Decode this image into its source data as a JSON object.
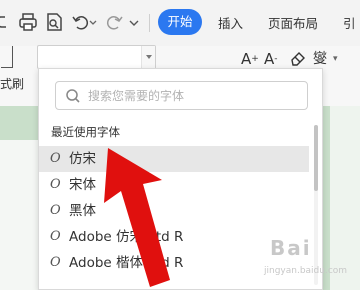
{
  "toolbar": {
    "icons": [
      "link-icon",
      "print-icon",
      "print-preview-icon",
      "undo-icon",
      "undo-dropdown-icon",
      "redo-icon",
      "more-dropdown-icon"
    ],
    "tabs": [
      {
        "label": "开始",
        "active": true
      },
      {
        "label": "插入",
        "active": false
      },
      {
        "label": "页面布局",
        "active": false
      },
      {
        "label": "引",
        "active": false
      }
    ],
    "accent_color": "#2b78f0"
  },
  "ribbon": {
    "format_painter_label": "式刷",
    "font_name_value": "",
    "grow_font": "A",
    "shrink_font": "A",
    "pinyin": "燮",
    "icons": [
      "grow-font-icon",
      "shrink-font-icon",
      "clear-format-icon",
      "pinyin-guide-icon"
    ]
  },
  "font_panel": {
    "search_placeholder": "搜索您需要的字体",
    "section_title": "最近使用字体",
    "font_icon": "O",
    "fonts": [
      {
        "name": "仿宋",
        "hovered": true
      },
      {
        "name": "宋体",
        "hovered": false
      },
      {
        "name": "黑体",
        "hovered": false
      },
      {
        "name": "Adobe 仿宋 Std R",
        "hovered": false
      },
      {
        "name": "Adobe 楷体 Std R",
        "hovered": false
      }
    ]
  },
  "annotation": {
    "arrow_color": "#e0100e"
  },
  "watermark": {
    "main": "Bai",
    "sub": "jingyan.baidu.com"
  }
}
